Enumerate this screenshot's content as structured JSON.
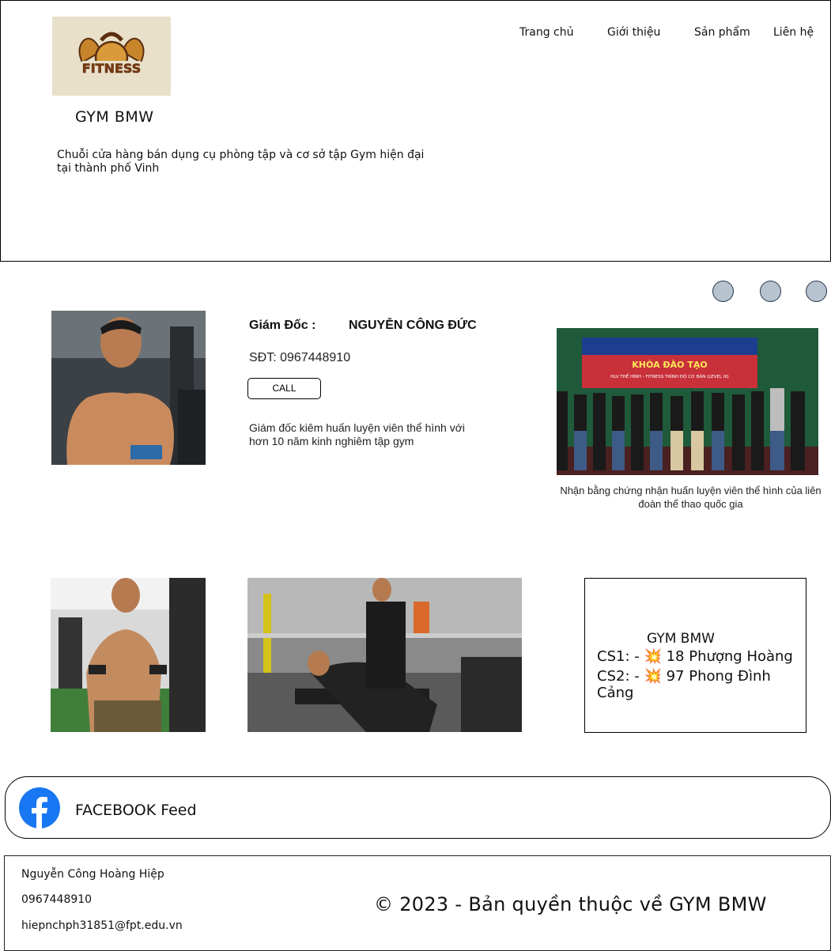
{
  "header": {
    "logo_text": "FITNESS",
    "brand": "GYM BMW",
    "tagline": "Chuỗi cửa hàng bán dụng cụ phòng tập và cơ sở tập Gym hiện đại tại thành phố Vinh",
    "nav": [
      "Trang chủ",
      "Giới thiệu",
      "Sản phẩm",
      "Liên hệ"
    ]
  },
  "carousel": {
    "dots": 3,
    "dot_color": "#b7c3cf"
  },
  "director": {
    "label": "Giám Đốc :",
    "name": "NGUYỄN CÔNG ĐỨC",
    "phone": "SĐT: 0967448910",
    "call_label": "CALL",
    "description": "Giám đốc kiêm huấn luyện viên thể hình với hơn 10 năm kinh nghiêm tập gym"
  },
  "certificate": {
    "banner_title": "KHÓA ĐÀO TẠO",
    "banner_subtitle": "HLV THỂ HÌNH - FITNESS TRÌNH ĐỘ CƠ BẢN (LEVEL III)",
    "caption": "Nhận bằng chứng nhận huấn luyện viên thể hình của liên đoàn thể thao quốc gia"
  },
  "branches": {
    "title": "GYM BMW",
    "lines": [
      "CS1: - 💥 18 Phượng Hoàng",
      "CS2: - 💥 97 Phong Đình Cảng"
    ]
  },
  "facebook": {
    "label": "FACEBOOK Feed",
    "color": "#1877f2"
  },
  "footer": {
    "name": "Nguyễn Công Hoàng Hiệp",
    "phone": "0967448910",
    "email": "hiepnchph31851@fpt.edu.vn",
    "copyright": "© 2023 - Bản quyền thuộc về GYM BMW"
  }
}
